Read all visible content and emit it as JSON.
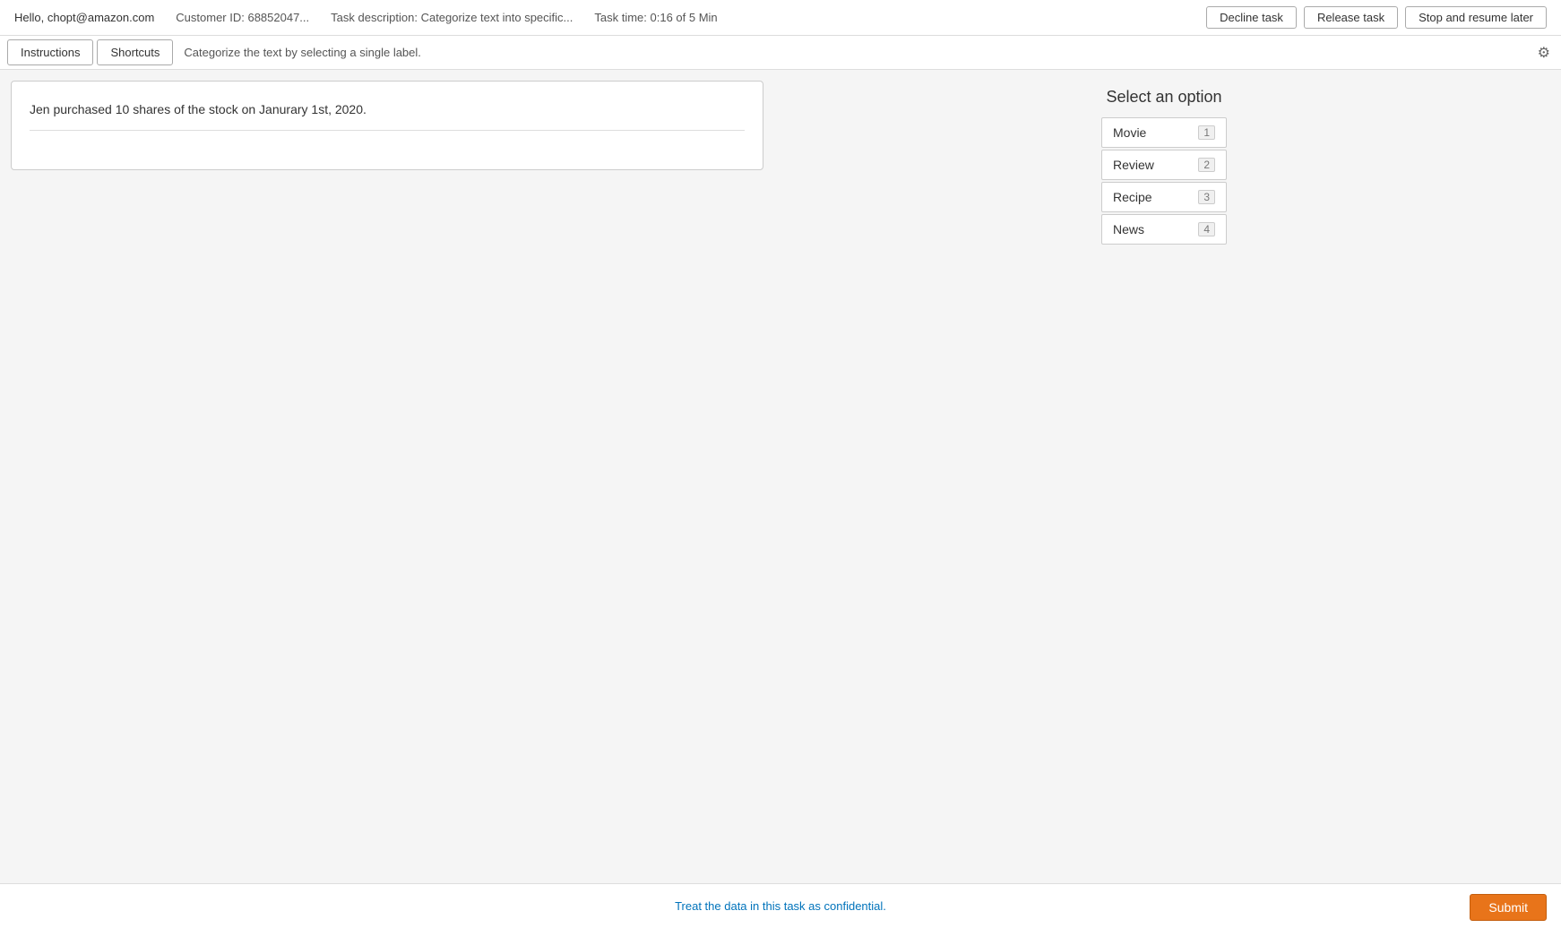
{
  "header": {
    "greeting": "Hello, chopt@amazon.com",
    "customer_id_label": "Customer ID: 68852047...",
    "task_description_label": "Task description: Categorize text into specific...",
    "task_time_label": "Task time: 0:16 of 5 Min",
    "decline_task_label": "Decline task",
    "release_task_label": "Release task",
    "stop_resume_label": "Stop and resume later"
  },
  "toolbar": {
    "instructions_label": "Instructions",
    "shortcuts_label": "Shortcuts",
    "instruction_text": "Categorize the text by selecting a single label.",
    "settings_icon": "⚙"
  },
  "text_panel": {
    "content": "Jen purchased 10 shares of the stock on Janurary 1st, 2020."
  },
  "options_panel": {
    "title": "Select an option",
    "options": [
      {
        "label": "Movie",
        "shortcut": "1"
      },
      {
        "label": "Review",
        "shortcut": "2"
      },
      {
        "label": "Recipe",
        "shortcut": "3"
      },
      {
        "label": "News",
        "shortcut": "4"
      }
    ]
  },
  "footer": {
    "note": "Treat the data in this task as confidential."
  },
  "submit": {
    "label": "Submit"
  }
}
